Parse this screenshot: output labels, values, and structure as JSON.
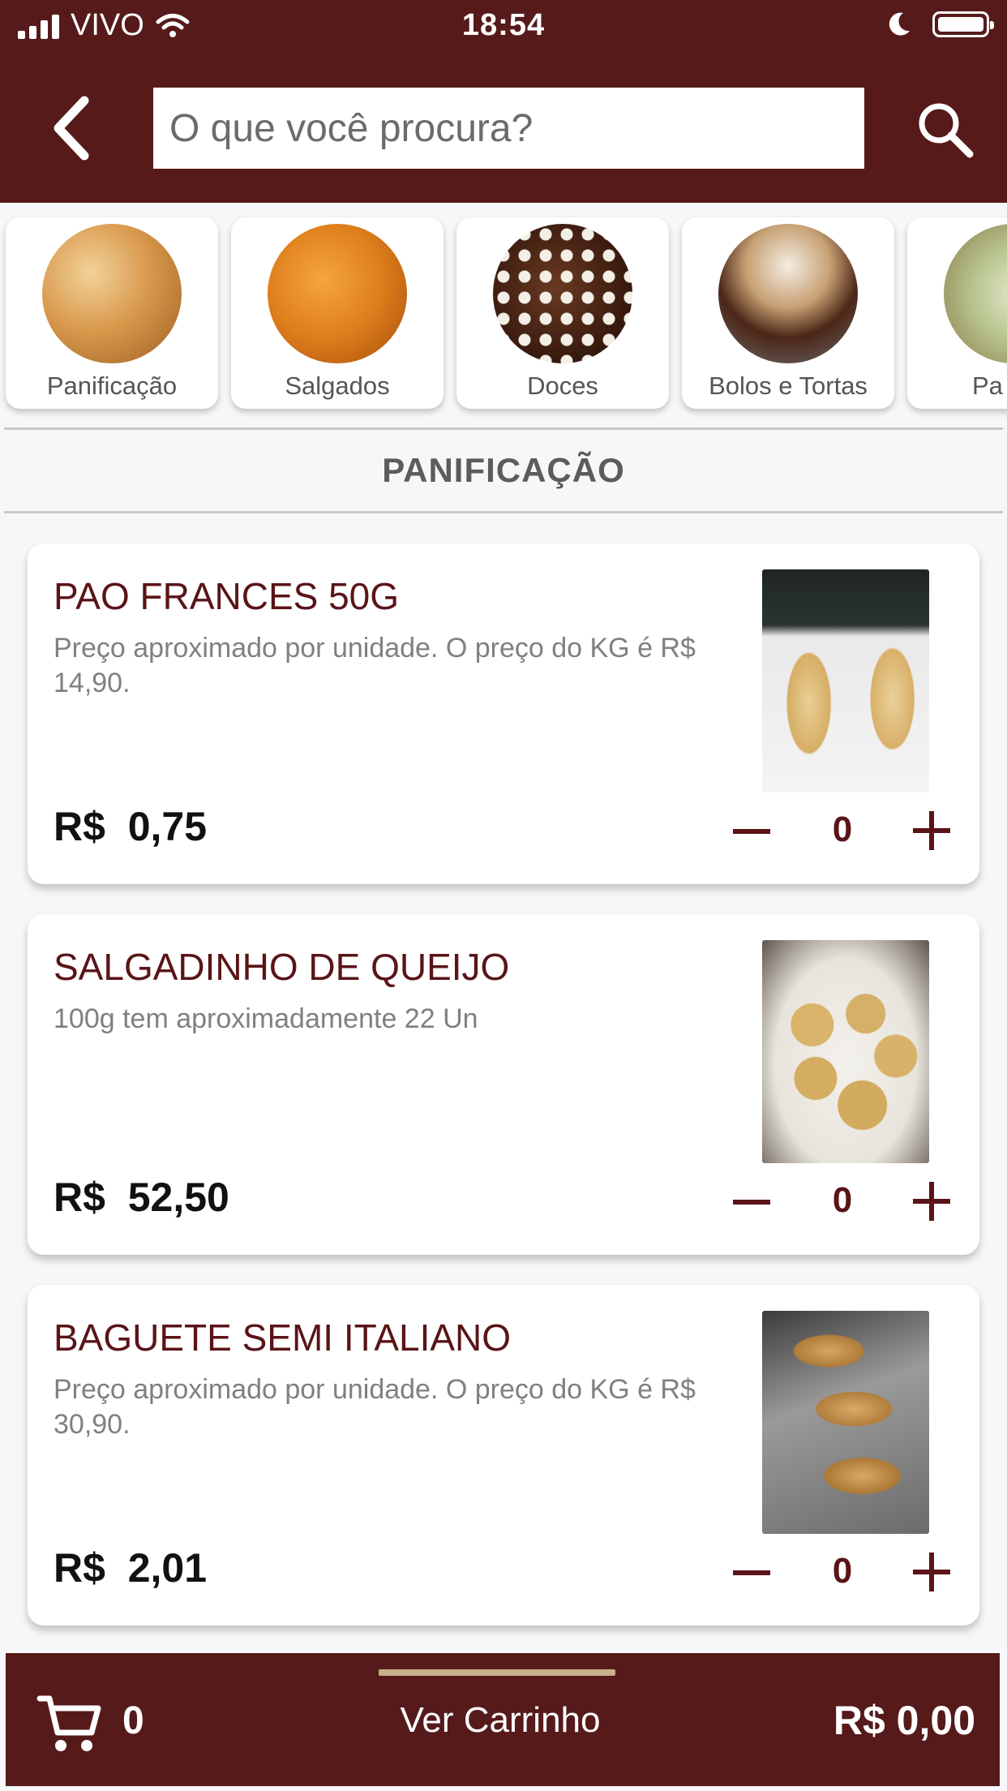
{
  "status_bar": {
    "carrier": "VIVO",
    "time": "18:54"
  },
  "header": {
    "search_placeholder": "O que você procura?",
    "back_icon": "chevron-left-icon",
    "search_icon": "search-icon"
  },
  "categories": [
    {
      "label": "Panificação"
    },
    {
      "label": "Salgados"
    },
    {
      "label": "Doces"
    },
    {
      "label": "Bolos e Tortas"
    },
    {
      "label": "Pa"
    }
  ],
  "section": {
    "title": "PANIFICAÇÃO"
  },
  "products": [
    {
      "name": "PAO FRANCES 50G",
      "description": "Preço aproximado por unidade. O preço do KG é R$ 14,90.",
      "price": "R$  0,75",
      "quantity": "0"
    },
    {
      "name": "SALGADINHO DE QUEIJO",
      "description": "100g tem aproximadamente 22 Un",
      "price": "R$  52,50",
      "quantity": "0"
    },
    {
      "name": "BAGUETE SEMI ITALIANO",
      "description": "Preço aproximado por unidade. O preço do KG é R$ 30,90.",
      "price": "R$  2,01",
      "quantity": "0"
    }
  ],
  "cart": {
    "count": "0",
    "view_label": "Ver Carrinho",
    "total": "R$ 0,00"
  },
  "colors": {
    "brand": "#561a1b",
    "accent_text": "#5a1418",
    "handle": "#c7b08a"
  }
}
